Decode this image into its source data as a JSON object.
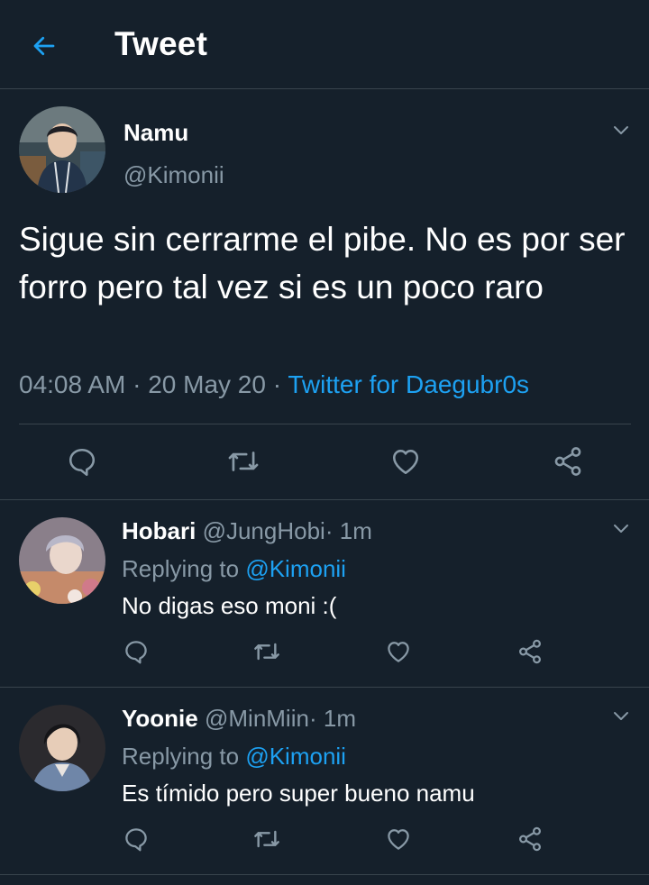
{
  "header": {
    "title": "Tweet",
    "back_icon": "arrow-left-icon"
  },
  "colors": {
    "background": "#15202b",
    "accent": "#1da1f2",
    "muted": "#8899a6",
    "divider": "#38444d"
  },
  "main_tweet": {
    "name": "Namu",
    "handle": "@Kimonii",
    "text": "Sigue sin cerrarme el pibe. No es por ser forro pero tal vez si es un poco raro",
    "time": "04:08 AM",
    "separator": "·",
    "date": "20 May 20",
    "source": "Twitter for Daegubr0s"
  },
  "replies": [
    {
      "name": "Hobari",
      "handle": "@JungHobi",
      "separator": "·",
      "time": "1m",
      "replying_prefix": "Replying to",
      "replying_to": "@Kimonii",
      "text": "No digas eso moni :("
    },
    {
      "name": "Yoonie",
      "handle": "@MinMiin",
      "separator": "·",
      "time": "1m",
      "replying_prefix": "Replying to",
      "replying_to": "@Kimonii",
      "text": "Es tímido pero super bueno namu"
    }
  ]
}
